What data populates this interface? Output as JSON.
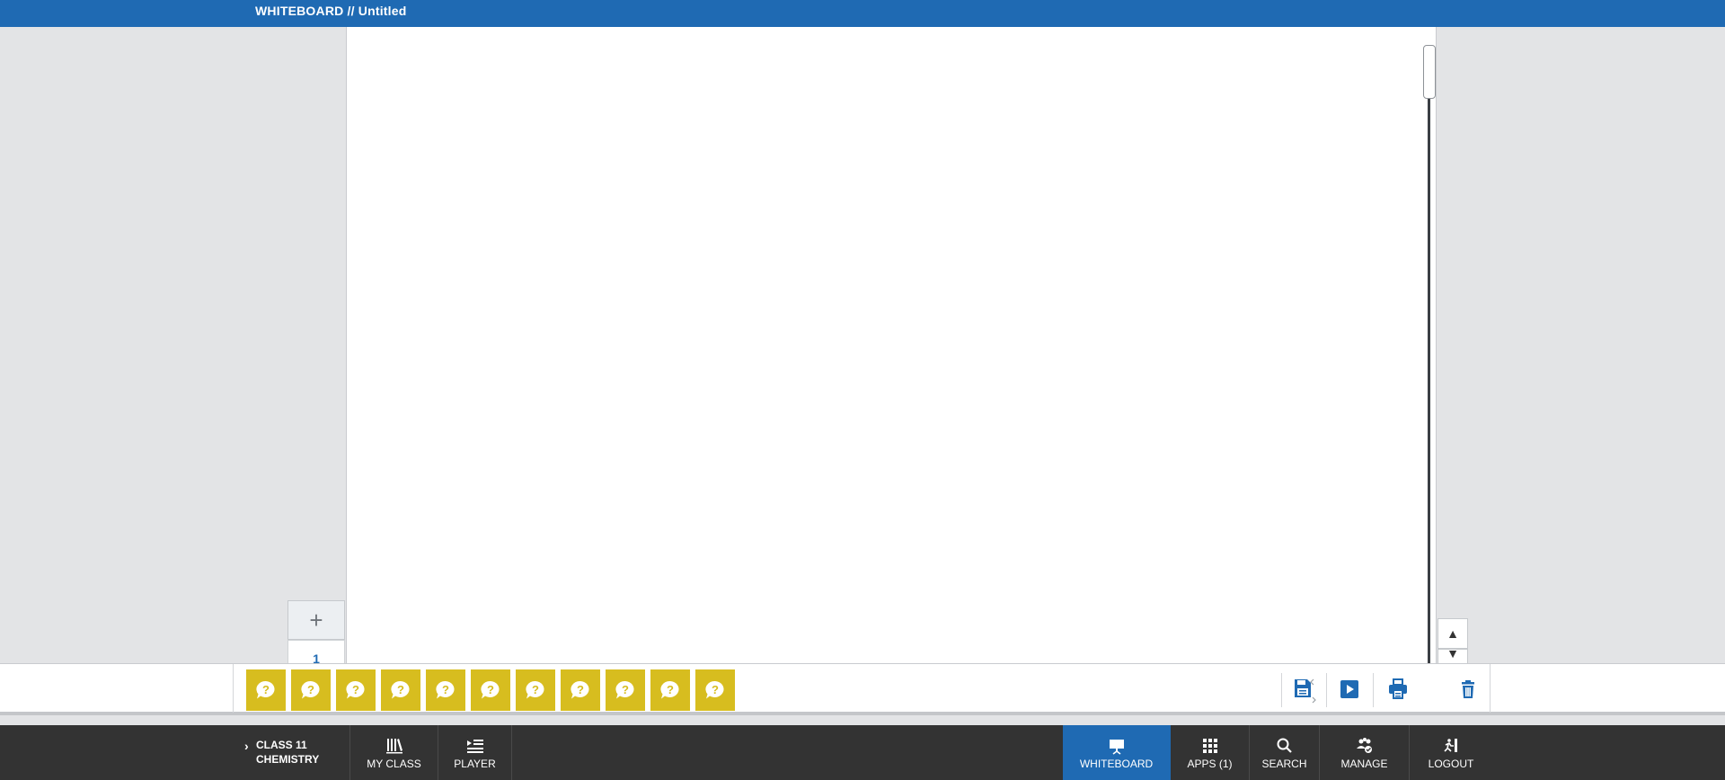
{
  "header": {
    "title": "WHITEBOARD // Untitled"
  },
  "pages": {
    "add_label": "+",
    "current_page": "1"
  },
  "scroll": {
    "up_label": "▲",
    "down_label": "▼"
  },
  "question_buttons": [
    {
      "icon": "question-bubble-icon"
    },
    {
      "icon": "question-bubble-icon"
    },
    {
      "icon": "question-bubble-icon"
    },
    {
      "icon": "question-bubble-icon"
    },
    {
      "icon": "question-bubble-icon"
    },
    {
      "icon": "question-bubble-icon"
    },
    {
      "icon": "question-bubble-icon"
    },
    {
      "icon": "question-bubble-icon"
    },
    {
      "icon": "question-bubble-icon"
    },
    {
      "icon": "question-bubble-icon"
    },
    {
      "icon": "question-bubble-icon"
    }
  ],
  "toolbar": {
    "tools": [
      "save-icon",
      "play-icon",
      "print-icon",
      "trash-icon"
    ]
  },
  "nav": {
    "class_line1": "CLASS 11",
    "class_line2": "CHEMISTRY",
    "my_class": "MY CLASS",
    "player": "PLAYER",
    "whiteboard": "WHITEBOARD",
    "apps": "APPS (1)",
    "search": "SEARCH",
    "manage": "MANAGE",
    "logout": "LOGOUT"
  },
  "colors": {
    "brand_blue": "#1f6ab3",
    "question_yellow": "#d7bd1f",
    "nav_bg": "#333333",
    "workspace_bg": "#e3e4e6"
  }
}
